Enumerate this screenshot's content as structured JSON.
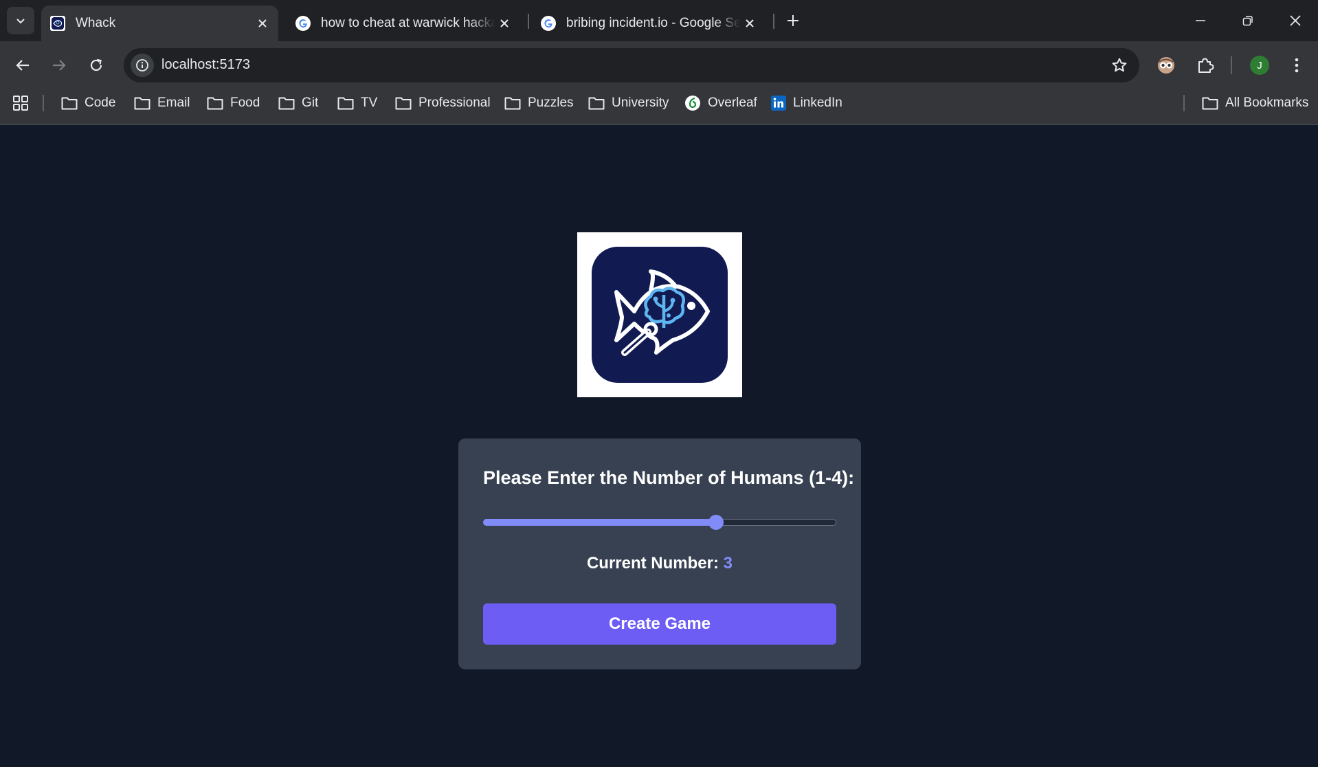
{
  "browser": {
    "tabs": [
      {
        "title": "Whack",
        "icon": "whack-favicon",
        "active": true
      },
      {
        "title": "how to cheat at warwick hackathon",
        "icon": "google-icon",
        "active": false
      },
      {
        "title": "bribing incident.io - Google Search",
        "icon": "google-icon",
        "active": false
      }
    ],
    "url": "localhost:5173",
    "profile_initial": "J",
    "bookmarks": [
      {
        "label": "Code",
        "icon": "folder-icon"
      },
      {
        "label": "Email",
        "icon": "folder-icon"
      },
      {
        "label": "Food",
        "icon": "folder-icon"
      },
      {
        "label": "Git",
        "icon": "folder-icon"
      },
      {
        "label": "TV",
        "icon": "folder-icon"
      },
      {
        "label": "Professional",
        "icon": "folder-icon"
      },
      {
        "label": "Puzzles",
        "icon": "folder-icon"
      },
      {
        "label": "University",
        "icon": "folder-icon"
      },
      {
        "label": "Overleaf",
        "icon": "overleaf-icon"
      },
      {
        "label": "LinkedIn",
        "icon": "linkedin-icon"
      }
    ],
    "all_bookmarks": "All Bookmarks"
  },
  "app": {
    "logo": "fish-brain-logo",
    "heading": "Please Enter the Number of Humans (1-4):",
    "slider": {
      "min": 1,
      "max": 4,
      "value": 3
    },
    "current_label": "Current Number:",
    "current_value": "3",
    "create_button": "Create Game"
  },
  "colors": {
    "page_bg": "#111827",
    "card_bg": "#374151",
    "accent": "#818cf8",
    "button": "#6d5df5",
    "logo_bg": "#111b52"
  }
}
